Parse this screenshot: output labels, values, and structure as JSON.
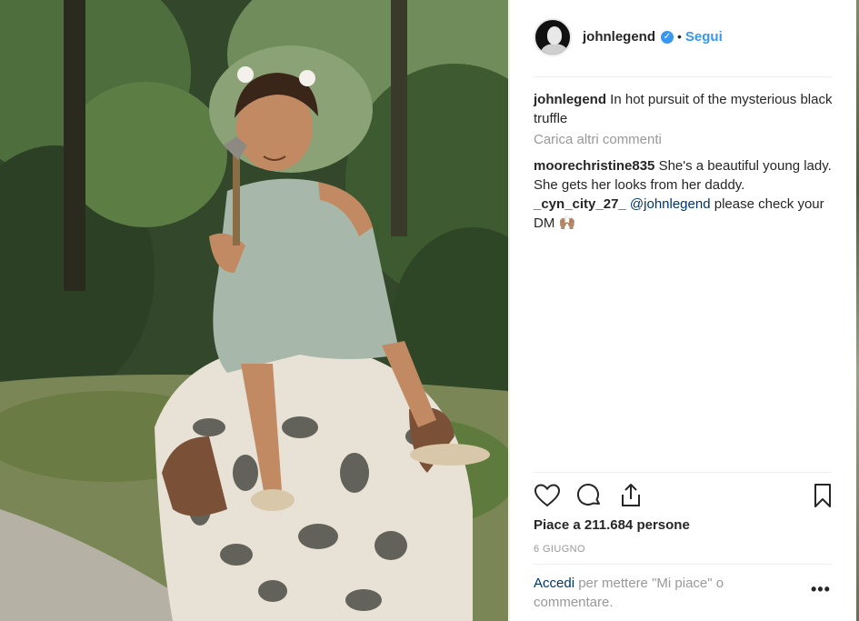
{
  "post": {
    "image_alt": "",
    "author": {
      "username": "johnlegend",
      "verified_symbol": "✓",
      "separator": "•",
      "follow_label": "Segui"
    },
    "comments": [
      {
        "username": "johnlegend",
        "text": "In hot pursuit of the mysterious black truffle"
      },
      {
        "username": "moorechristine835",
        "text": "She's a beautiful young lady. She gets her looks from her daddy."
      },
      {
        "username": "_cyn_city_27_",
        "mention": "@johnlegend",
        "text": "please check your DM 🙌🏽"
      }
    ],
    "load_more_label": "Carica altri commenti",
    "likes_label": "Piace a 211.684 persone",
    "date_label": "6 GIUGNO",
    "login_prompt": {
      "link_label": "Accedi",
      "text": "per mettere \"Mi piace\" o commentare."
    },
    "more_options_label": "•••"
  },
  "icons": {
    "like": "heart-icon",
    "comment": "comment-icon",
    "share": "share-icon",
    "save": "bookmark-icon",
    "verified": "verified-badge-icon"
  },
  "colors": {
    "accent": "#3897f0",
    "link": "#003569",
    "muted": "#999999",
    "text": "#262626"
  }
}
